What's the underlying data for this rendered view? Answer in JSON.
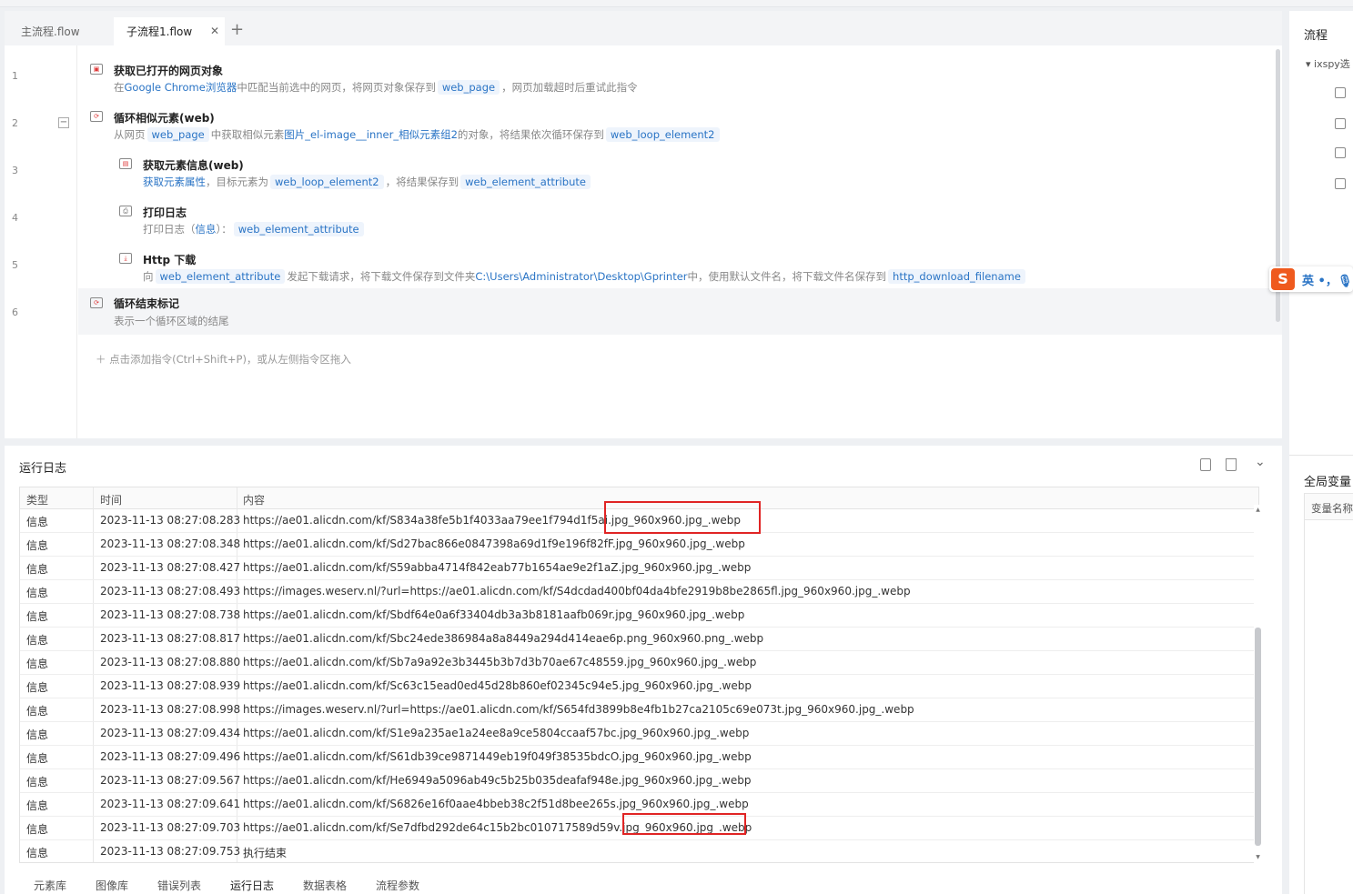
{
  "tabs": {
    "main": "主流程.flow",
    "sub": "子流程1.flow",
    "close": "✕",
    "add": "+"
  },
  "lines": [
    "1",
    "2",
    "3",
    "4",
    "5",
    "6"
  ],
  "fold_symbol": "−",
  "commands": [
    {
      "title": "获取已打开的网页对象",
      "desc": [
        "在",
        "Google Chrome浏览器",
        "中匹配当前选中的网页，将网页对象保存到",
        "web_page",
        "，网页加载超时后重试此指令"
      ]
    },
    {
      "title": "循环相似元素(web)",
      "desc": [
        "从网页",
        "web_page",
        "中获取相似元素",
        "图片_el-image__inner_相似元素组2",
        "的对象，将结果依次循环保存到",
        "web_loop_element2"
      ]
    },
    {
      "title": "获取元素信息(web)",
      "desc": [
        "获取元素属性",
        "，目标元素为",
        "web_loop_element2",
        "，将结果保存到",
        "web_element_attribute"
      ]
    },
    {
      "title": "打印日志",
      "desc": [
        "打印日志（",
        "信息",
        "）：",
        "web_element_attribute"
      ]
    },
    {
      "title": "Http 下载",
      "desc": [
        "向",
        "web_element_attribute",
        "发起下载请求，将下载文件保存到文件夹",
        "C:\\Users\\Administrator\\Desktop\\Gprinter",
        "中，使用默认文件名，将下载文件名保存到",
        "http_download_filename"
      ]
    },
    {
      "title": "循环结束标记",
      "desc": [
        "表示一个循环区域的结尾"
      ]
    }
  ],
  "add_hint": "＋  点击添加指令(Ctrl+Shift+P)，或从左侧指令区拖入",
  "right_panel": {
    "title": "流程",
    "tree_item": "▾  ixspy选",
    "global_vars": "全局变量",
    "var_name_header": "变量名称"
  },
  "ime": {
    "logo": "S",
    "text": "英 •，🎙"
  },
  "log": {
    "title": "运行日志",
    "columns": [
      "类型",
      "时间",
      "内容"
    ],
    "rows": [
      [
        "信息",
        "2023-11-13 08:27:08.283",
        "https://ae01.alicdn.com/kf/S834a38fe5b1f4033aa79ee1f794d1f5ai.jpg_960x960.jpg_.webp"
      ],
      [
        "信息",
        "2023-11-13 08:27:08.348",
        "https://ae01.alicdn.com/kf/Sd27bac866e0847398a69d1f9e196f82fF.jpg_960x960.jpg_.webp"
      ],
      [
        "信息",
        "2023-11-13 08:27:08.427",
        "https://ae01.alicdn.com/kf/S59abba4714f842eab77b1654ae9e2f1aZ.jpg_960x960.jpg_.webp"
      ],
      [
        "信息",
        "2023-11-13 08:27:08.493",
        "https://images.weserv.nl/?url=https://ae01.alicdn.com/kf/S4dcdad400bf04da4bfe2919b8be2865fl.jpg_960x960.jpg_.webp"
      ],
      [
        "信息",
        "2023-11-13 08:27:08.738",
        "https://ae01.alicdn.com/kf/Sbdf64e0a6f33404db3a3b8181aafb069r.jpg_960x960.jpg_.webp"
      ],
      [
        "信息",
        "2023-11-13 08:27:08.817",
        "https://ae01.alicdn.com/kf/Sbc24ede386984a8a8449a294d414eae6p.png_960x960.png_.webp"
      ],
      [
        "信息",
        "2023-11-13 08:27:08.880",
        "https://ae01.alicdn.com/kf/Sb7a9a92e3b3445b3b7d3b70ae67c48559.jpg_960x960.jpg_.webp"
      ],
      [
        "信息",
        "2023-11-13 08:27:08.939",
        "https://ae01.alicdn.com/kf/Sc63c15ead0ed45d28b860ef02345c94e5.jpg_960x960.jpg_.webp"
      ],
      [
        "信息",
        "2023-11-13 08:27:08.998",
        "https://images.weserv.nl/?url=https://ae01.alicdn.com/kf/S654fd3899b8e4fb1b27ca2105c69e073t.jpg_960x960.jpg_.webp"
      ],
      [
        "信息",
        "2023-11-13 08:27:09.434",
        "https://ae01.alicdn.com/kf/S1e9a235ae1a24ee8a9ce5804ccaaf57bc.jpg_960x960.jpg_.webp"
      ],
      [
        "信息",
        "2023-11-13 08:27:09.496",
        "https://ae01.alicdn.com/kf/S61db39ce9871449eb19f049f38535bdcO.jpg_960x960.jpg_.webp"
      ],
      [
        "信息",
        "2023-11-13 08:27:09.567",
        "https://ae01.alicdn.com/kf/He6949a5096ab49c5b25b035deafaf948e.jpg_960x960.jpg_.webp"
      ],
      [
        "信息",
        "2023-11-13 08:27:09.641",
        "https://ae01.alicdn.com/kf/S6826e16f0aae4bbeb38c2f51d8bee265s.jpg_960x960.jpg_.webp"
      ],
      [
        "信息",
        "2023-11-13 08:27:09.703",
        "https://ae01.alicdn.com/kf/Se7dfbd292de64c15b2bc010717589d59v.jpg_960x960.jpg_.webp"
      ],
      [
        "信息",
        "2023-11-13 08:27:09.753",
        "执行结束"
      ]
    ]
  },
  "bottom_tabs": [
    "元素库",
    "图像库",
    "错误列表",
    "运行日志",
    "数据表格",
    "流程参数"
  ],
  "icons": {
    "export": "export-log-icon",
    "delete": "trash-icon",
    "collapse": "chevron-down-icon"
  },
  "colors": {
    "accent": "#2a74c5",
    "annotation": "#e02424",
    "ime": "#ef5a1e"
  }
}
